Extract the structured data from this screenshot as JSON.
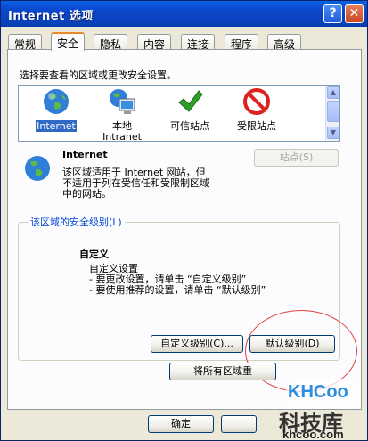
{
  "window": {
    "title": "Internet 选项",
    "help_glyph": "?",
    "close_glyph": "✕"
  },
  "tabs": [
    {
      "label": "常规"
    },
    {
      "label": "安全"
    },
    {
      "label": "隐私"
    },
    {
      "label": "内容"
    },
    {
      "label": "连接"
    },
    {
      "label": "程序"
    },
    {
      "label": "高级"
    }
  ],
  "security": {
    "instruction": "选择要查看的区域或更改安全设置。",
    "zones": [
      {
        "label": "Internet",
        "icon": "globe-icon"
      },
      {
        "label": "本地\nIntranet",
        "icon": "intranet-monitor-icon"
      },
      {
        "label": "可信站点",
        "icon": "checkmark-icon"
      },
      {
        "label": "受限站点",
        "icon": "restricted-icon"
      }
    ],
    "selected_zone_name": "Internet",
    "zone_description_1": "该区域适用于 Internet 网站，但",
    "zone_description_2": "不适用于列在受信任和受限制区域",
    "zone_description_3": "中的网站。",
    "sites_button": "站点(S)",
    "group_title": "该区域的安全级别(L)",
    "level_title": "自定义",
    "level_line_1": "自定义设置",
    "level_line_2": "- 要更改设置，请单击 “自定义级别”",
    "level_line_3": "- 要使用推荐的设置，请单击 “默认级别”",
    "custom_level_button": "自定义级别(C)...",
    "default_level_button": "默认级别(D)",
    "reset_all_button": "将所有区域重"
  },
  "footer": {
    "ok_button": "确定"
  },
  "watermark": {
    "brand": "KHCoo",
    "cn": "科技库",
    "url": "khcoo.com"
  },
  "colors": {
    "title_bar": "#0a45c9",
    "active_tab_accent": "#e68b2c",
    "selection": "#316ac5",
    "annotation": "#e04040"
  }
}
